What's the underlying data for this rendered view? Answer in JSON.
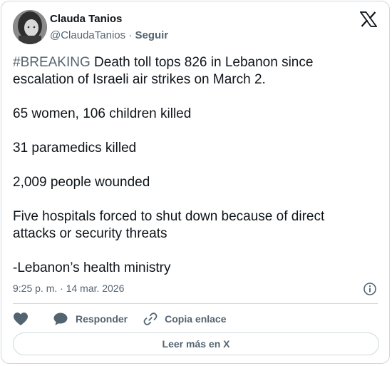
{
  "author": {
    "name": "Clauda Tanios",
    "handle": "@ClaudaTanios",
    "separator": " · ",
    "follow_label": "Seguir"
  },
  "post": {
    "hashtag": "#BREAKING",
    "headline_rest": " Death toll tops 826 in Lebanon since escalation of Israeli air strikes on March 2.",
    "lines": [
      "65 women, 106 children killed",
      "31 paramedics killed",
      "2,009 people wounded",
      "Five hospitals forced to shut down because of direct attacks or security threats",
      "-Lebanon’s health ministry"
    ],
    "timestamp": "9:25 p. m. · 14 mar. 2026"
  },
  "actions": {
    "reply_label": "Responder",
    "copy_link_label": "Copia enlace"
  },
  "footer": {
    "read_more_label": "Leer más en X"
  },
  "colors": {
    "text": "#0f1419",
    "secondary": "#536471",
    "border": "#cfd9de"
  },
  "icons": [
    "x-logo-icon",
    "heart-icon",
    "reply-bubble-icon",
    "link-icon",
    "info-icon"
  ]
}
